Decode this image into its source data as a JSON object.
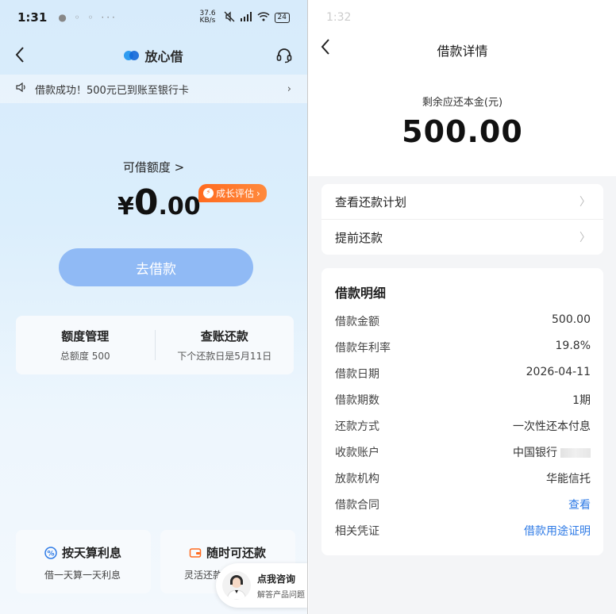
{
  "left": {
    "status": {
      "time": "1:31",
      "net_speed": "37.6 KB/s",
      "battery": "24"
    },
    "nav": {
      "brand": "放心借"
    },
    "notice": {
      "text": "借款成功！500元已到账至银行卡"
    },
    "quota": {
      "label": "可借额度 >",
      "currency": "¥",
      "integer": "0",
      "decimal": ".00",
      "growth_badge": "成长评估"
    },
    "borrow_button": "去借款",
    "cards": [
      {
        "title": "额度管理",
        "sub": "总额度 500"
      },
      {
        "title": "查账还款",
        "sub": "下个还款日是5月11日"
      }
    ],
    "features": [
      {
        "title": "按天算利息",
        "sub": "借一天算一天利息"
      },
      {
        "title": "随时可还款",
        "sub": "灵活还款"
      }
    ],
    "consult": {
      "title": "点我咨询",
      "sub": "解答产品问题"
    }
  },
  "right": {
    "status": {
      "time": "1:32"
    },
    "nav": {
      "title": "借款详情"
    },
    "remain": {
      "label": "剩余应还本金(元)",
      "amount": "500.00"
    },
    "menu": [
      {
        "label": "查看还款计划"
      },
      {
        "label": "提前还款"
      }
    ],
    "detail": {
      "title": "借款明细",
      "rows": [
        {
          "k": "借款金额",
          "v": "500.00"
        },
        {
          "k": "借款年利率",
          "v": "19.8%"
        },
        {
          "k": "借款日期",
          "v": "2026-04-11"
        },
        {
          "k": "借款期数",
          "v": "1期"
        },
        {
          "k": "还款方式",
          "v": "一次性还本付息"
        },
        {
          "k": "收款账户",
          "v": "中国银行"
        },
        {
          "k": "放款机构",
          "v": "华能信托"
        },
        {
          "k": "借款合同",
          "v": "查看"
        },
        {
          "k": "相关凭证",
          "v": "借款用途证明"
        }
      ]
    }
  },
  "colors": {
    "accent_blue": "#2f7be6",
    "button_blue": "#90baf5",
    "badge_orange": "#ff6a1f"
  }
}
